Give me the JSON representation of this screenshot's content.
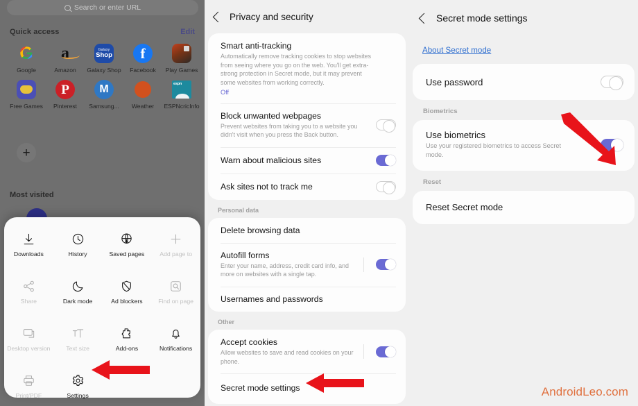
{
  "left_panel": {
    "search": {
      "placeholder": "Search or enter URL",
      "icon": "search-icon"
    },
    "quick_access": {
      "title": "Quick access",
      "edit_label": "Edit",
      "items": [
        {
          "label": "Google",
          "icon": "google-icon"
        },
        {
          "label": "Amazon",
          "icon": "amazon-icon"
        },
        {
          "label": "Galaxy Shop",
          "icon": "galaxy-shop-icon",
          "line1": "Galaxy",
          "line2": "Shop"
        },
        {
          "label": "Facebook",
          "icon": "facebook-icon",
          "glyph": "f"
        },
        {
          "label": "Play Games",
          "icon": "play-games-icon"
        },
        {
          "label": "Free Games",
          "icon": "free-games-icon"
        },
        {
          "label": "Pinterest",
          "icon": "pinterest-icon",
          "glyph": "P"
        },
        {
          "label": "Samsung...",
          "icon": "samsung-icon",
          "glyph": "M"
        },
        {
          "label": "Weather",
          "icon": "accuweather-icon"
        },
        {
          "label": "ESPNcricInfo",
          "icon": "espncricinfo-icon",
          "glyph": "espn"
        }
      ]
    },
    "add_button_label": "+",
    "most_visited_title": "Most visited",
    "menu_sheet": {
      "items": [
        {
          "label": "Downloads",
          "icon": "download-icon",
          "dimmed": false
        },
        {
          "label": "History",
          "icon": "clock-icon",
          "dimmed": false
        },
        {
          "label": "Saved pages",
          "icon": "globe-download-icon",
          "dimmed": false
        },
        {
          "label": "Add page to",
          "icon": "plus-icon",
          "dimmed": true
        },
        {
          "label": "Share",
          "icon": "share-icon",
          "dimmed": true
        },
        {
          "label": "Dark mode",
          "icon": "moon-icon",
          "dimmed": false
        },
        {
          "label": "Ad blockers",
          "icon": "block-shield-icon",
          "dimmed": false
        },
        {
          "label": "Find on page",
          "icon": "find-in-page-icon",
          "dimmed": true
        },
        {
          "label": "Desktop version",
          "icon": "desktop-icon",
          "dimmed": true
        },
        {
          "label": "Text size",
          "icon": "text-size-icon",
          "dimmed": true
        },
        {
          "label": "Add-ons",
          "icon": "addons-icon",
          "dimmed": false
        },
        {
          "label": "Notifications",
          "icon": "bell-icon",
          "dimmed": false
        },
        {
          "label": "Print/PDF",
          "icon": "printer-icon",
          "dimmed": true
        },
        {
          "label": "Settings",
          "icon": "gear-icon",
          "dimmed": false
        }
      ]
    }
  },
  "middle_panel": {
    "header": {
      "title": "Privacy and security",
      "back_icon": "back-chevron-icon"
    },
    "group1": [
      {
        "title": "Smart anti-tracking",
        "subtitle": "Automatically remove tracking cookies to stop websites from seeing where you go on the web. You'll get extra-strong protection in Secret mode, but it may prevent some websites from working correctly.",
        "state": "Off",
        "toggle": null
      },
      {
        "title": "Block unwanted webpages",
        "subtitle": "Prevent websites from taking you to a website you didn't visit when you press the Back button.",
        "toggle": "off"
      },
      {
        "title": "Warn about malicious sites",
        "subtitle": "",
        "toggle": "on"
      },
      {
        "title": "Ask sites not to track me",
        "subtitle": "",
        "toggle": "off"
      }
    ],
    "section_personal_data": "Personal data",
    "group2": [
      {
        "title": "Delete browsing data",
        "subtitle": "",
        "toggle": null
      },
      {
        "title": "Autofill forms",
        "subtitle": "Enter your name, address, credit card info, and more on websites with a single tap.",
        "toggle": "on",
        "has_divider": true
      },
      {
        "title": "Usernames and passwords",
        "subtitle": "",
        "toggle": null
      }
    ],
    "section_other": "Other",
    "group3": [
      {
        "title": "Accept cookies",
        "subtitle": "Allow websites to save and read cookies on your phone.",
        "toggle": "on",
        "has_divider": true
      },
      {
        "title": "Secret mode settings",
        "subtitle": "",
        "toggle": null
      }
    ]
  },
  "right_panel": {
    "header": {
      "title": "Secret mode settings",
      "back_icon": "back-chevron-icon"
    },
    "about_link": "About Secret mode",
    "use_password": {
      "title": "Use password",
      "toggle": "off"
    },
    "section_biometrics": "Biometrics",
    "use_biometrics": {
      "title": "Use biometrics",
      "subtitle": "Use your registered biometrics to access Secret mode.",
      "toggle": "on"
    },
    "section_reset": "Reset",
    "reset_item": {
      "title": "Reset Secret mode"
    }
  },
  "annotations": {
    "arrow_color": "#e8131a",
    "arrow_settings_target": "settings-menu-item",
    "arrow_secret_mode_target": "secret-mode-settings-row",
    "arrow_biometrics_target": "use-biometrics-toggle"
  },
  "watermark": {
    "text": "AndroidLeo.com",
    "color": "#e0713f"
  },
  "colors": {
    "toggle_on": "#6a6ad4",
    "accent_link": "#2f6fd0",
    "page_bg": "#f0f0f0",
    "card_bg": "#fdfdfd",
    "scrim": "#6f6f6f"
  }
}
